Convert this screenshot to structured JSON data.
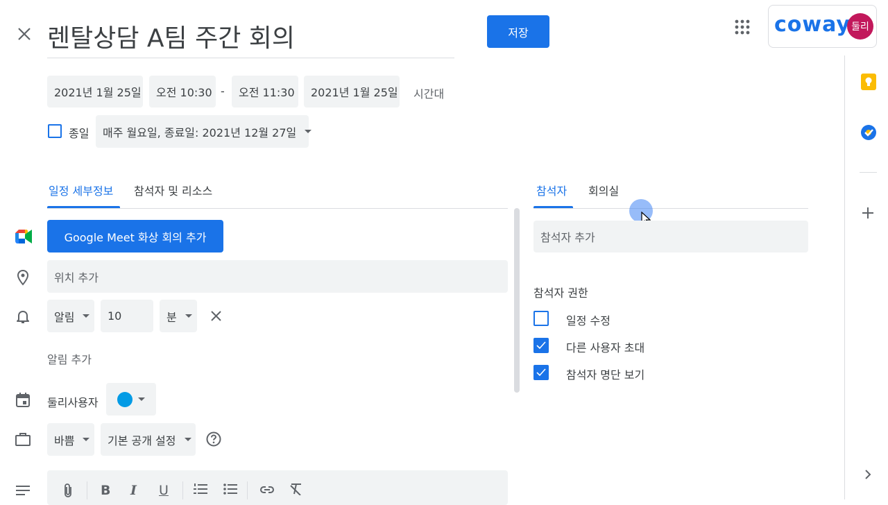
{
  "header": {
    "title": "렌탈상담 A팀 주간 회의",
    "save_label": "저장",
    "brand_text": "coway",
    "avatar_text": "둘리"
  },
  "datetime": {
    "start_date": "2021년 1월 25일",
    "start_time": "오전 10:30",
    "separator": "-",
    "end_time": "오전 11:30",
    "end_date": "2021년 1월 25일",
    "timezone_label": "시간대",
    "all_day_label": "종일",
    "recurrence": "매주 월요일, 종료일: 2021년 12월 27일"
  },
  "left_tabs": [
    "일정 세부정보",
    "참석자 및 리소스"
  ],
  "details": {
    "meet_button": "Google Meet 화상 회의 추가",
    "location_placeholder": "위치 추가",
    "notification_type": "알림",
    "notification_value": "10",
    "notification_unit": "분",
    "add_notification": "알림 추가",
    "calendar_owner": "둘리사용자",
    "calendar_color": "#039be5",
    "busy_status": "바쁨",
    "visibility": "기본 공개 설정"
  },
  "right_tabs": [
    "참석자",
    "회의실"
  ],
  "guests": {
    "add_placeholder": "참석자 추가",
    "permissions_title": "참석자 권한",
    "permissions": [
      {
        "label": "일정 수정",
        "checked": false
      },
      {
        "label": "다른 사용자 초대",
        "checked": true
      },
      {
        "label": "참석자 명단 보기",
        "checked": true
      }
    ]
  },
  "colors": {
    "accent": "#1a73e8",
    "keep": "#fbbc04",
    "brand": "#1a73e8",
    "avatar": "#c2185b"
  }
}
